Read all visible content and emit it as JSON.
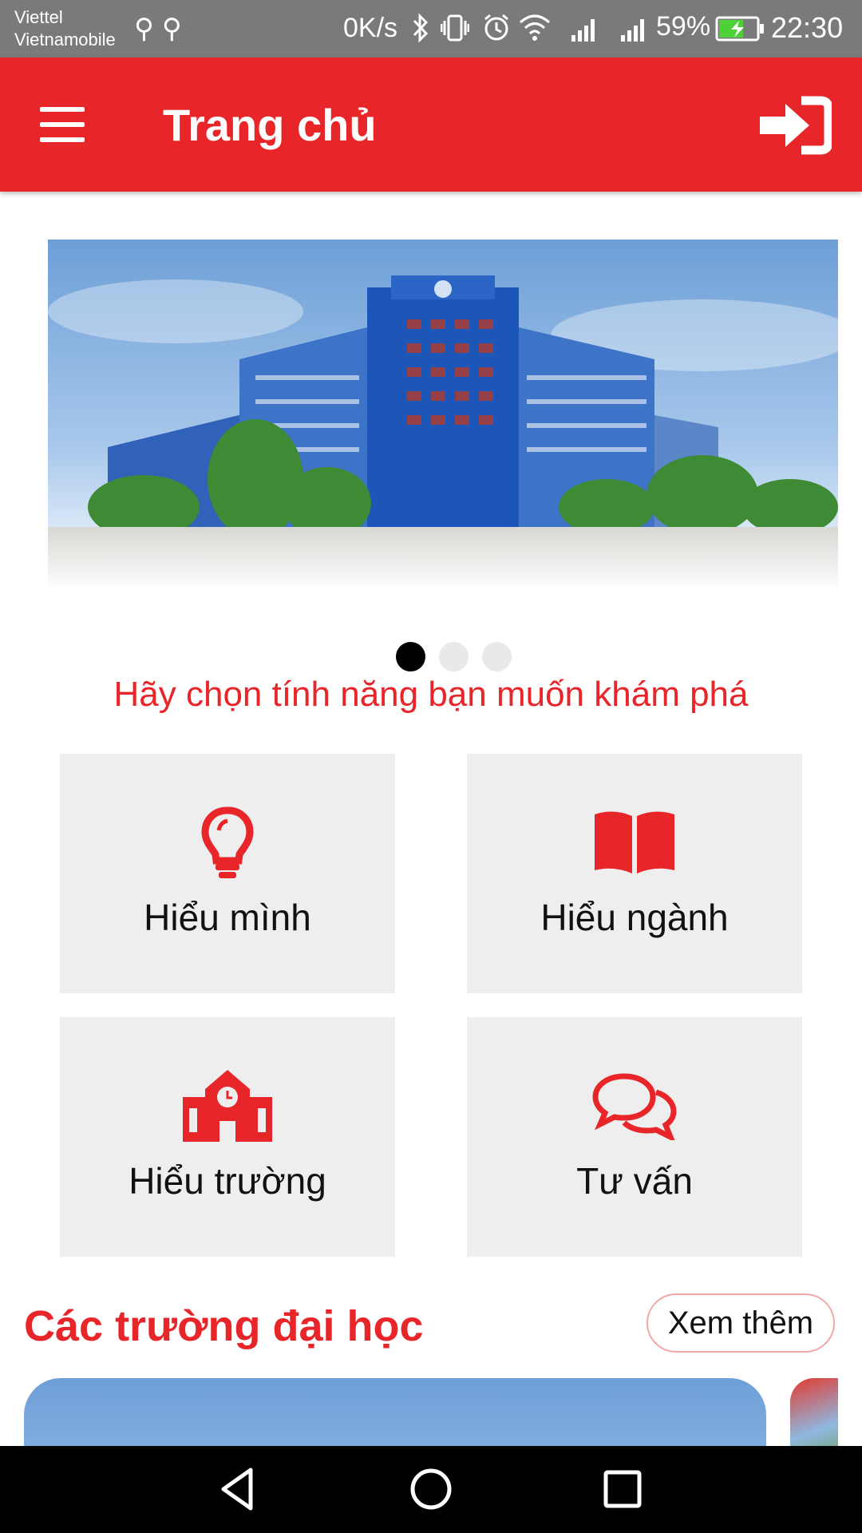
{
  "status_bar": {
    "carrier1": "Viettel",
    "carrier2": "Vietnamobile",
    "net_speed": "0K/s",
    "battery": "59%",
    "time": "22:30",
    "icons": [
      "usb-icon",
      "usb-icon",
      "bluetooth-icon",
      "vibrate-icon",
      "alarm-icon",
      "wifi-icon",
      "signal-icon",
      "signal-icon",
      "battery-charging-icon"
    ]
  },
  "app_bar": {
    "title": "Trang chủ",
    "menu_icon": "hamburger-menu-icon",
    "login_icon": "sign-in-icon"
  },
  "banner": {
    "slides": 3,
    "active_slide": 1
  },
  "prompt": "Hãy chọn tính năng bạn muốn khám phá",
  "features": [
    {
      "label": "Hiểu mình",
      "icon": "lightbulb-icon"
    },
    {
      "label": "Hiểu ngành",
      "icon": "book-icon"
    },
    {
      "label": "Hiểu trường",
      "icon": "school-icon"
    },
    {
      "label": "Tư vấn",
      "icon": "chat-bubbles-icon"
    }
  ],
  "universities": {
    "title": "Các trường đại học",
    "more": "Xem thêm"
  },
  "colors": {
    "primary": "#e8262a",
    "tile_bg": "#eeeeee",
    "status_bar": "#7a7a7a"
  }
}
